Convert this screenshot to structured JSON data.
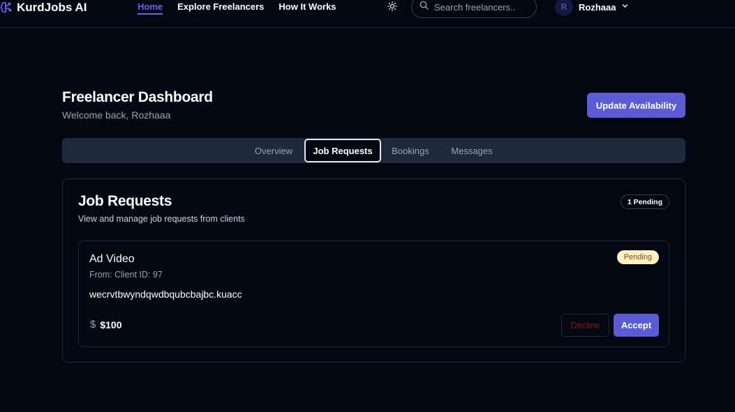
{
  "app": {
    "name": "KurdJobs AI",
    "logo_icon": "brain-circuit-icon",
    "accent_color": "#6366f1",
    "button_color": "#5b5bd6"
  },
  "nav": {
    "items": [
      {
        "label": "Home",
        "active": true
      },
      {
        "label": "Explore Freelancers",
        "active": false
      },
      {
        "label": "How It Works",
        "active": false
      }
    ]
  },
  "header": {
    "theme_icon": "sun-icon",
    "search_placeholder": "Search freelancers..",
    "search_icon": "search-icon",
    "user": {
      "initial": "R",
      "name": "Rozhaaa",
      "menu_icon": "chevron-down-icon"
    }
  },
  "dashboard": {
    "title": "Freelancer Dashboard",
    "subtitle": "Welcome back, Rozhaaa",
    "update_button": "Update Availability"
  },
  "tabs": [
    {
      "label": "Overview",
      "active": false
    },
    {
      "label": "Job Requests",
      "active": true
    },
    {
      "label": "Bookings",
      "active": false
    },
    {
      "label": "Messages",
      "active": false
    }
  ],
  "job_requests": {
    "title": "Job Requests",
    "subtitle": "View and manage job requests from clients",
    "pending_count_label": "1 Pending",
    "requests": [
      {
        "title": "Ad Video",
        "from": "From: Client ID: 97",
        "description": "wecrvtbwyndqwdbqubcbajbc.kuacc",
        "status": "Pending",
        "currency_symbol": "$",
        "price": "$100",
        "decline_label": "Decline",
        "accept_label": "Accept"
      }
    ]
  }
}
